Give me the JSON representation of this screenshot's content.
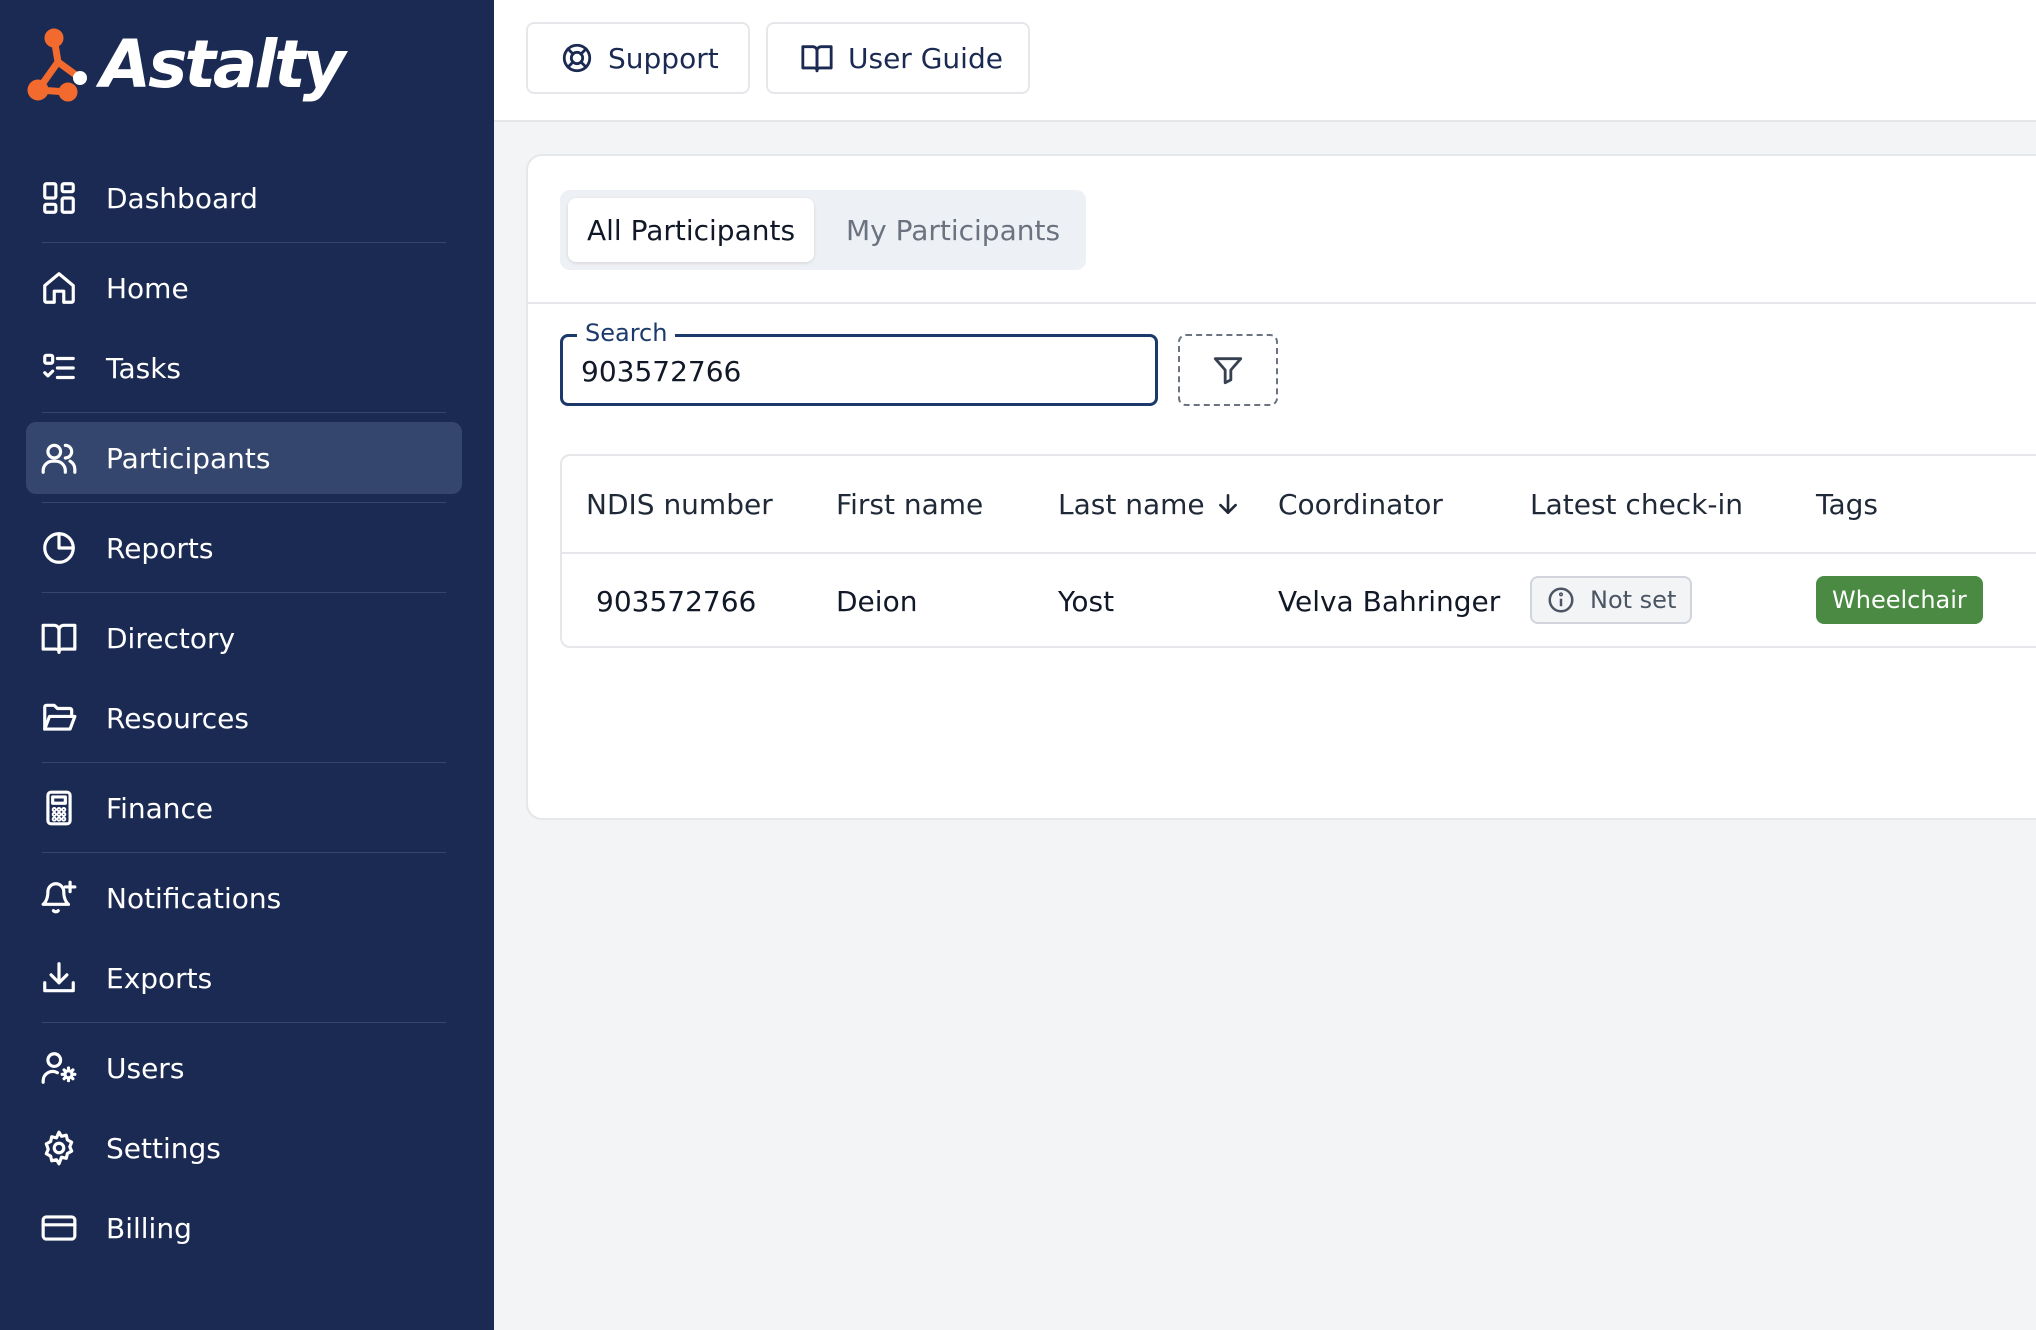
{
  "brand": {
    "name": "Astalty",
    "accent": "#f26a2e",
    "sidebar_bg": "#1b2a52"
  },
  "sidebar": {
    "items": [
      {
        "label": "Dashboard",
        "icon": "dashboard-icon",
        "active": false
      },
      {
        "label": "Home",
        "icon": "home-icon",
        "active": false
      },
      {
        "label": "Tasks",
        "icon": "tasks-icon",
        "active": false
      },
      {
        "label": "Participants",
        "icon": "participants-icon",
        "active": true
      },
      {
        "label": "Reports",
        "icon": "pie-chart-icon",
        "active": false
      },
      {
        "label": "Directory",
        "icon": "book-icon",
        "active": false
      },
      {
        "label": "Resources",
        "icon": "folder-icon",
        "active": false
      },
      {
        "label": "Finance",
        "icon": "calculator-icon",
        "active": false
      },
      {
        "label": "Notifications",
        "icon": "bell-plus-icon",
        "active": false
      },
      {
        "label": "Exports",
        "icon": "download-icon",
        "active": false
      },
      {
        "label": "Users",
        "icon": "user-gear-icon",
        "active": false
      },
      {
        "label": "Settings",
        "icon": "gear-icon",
        "active": false
      },
      {
        "label": "Billing",
        "icon": "credit-card-icon",
        "active": false
      }
    ]
  },
  "topbar": {
    "support_label": "Support",
    "user_guide_label": "User Guide"
  },
  "participants": {
    "tabs": [
      {
        "label": "All Participants",
        "active": true
      },
      {
        "label": "My Participants",
        "active": false
      }
    ],
    "search": {
      "label": "Search",
      "value": "903572766"
    },
    "table": {
      "columns": [
        "NDIS number",
        "First name",
        "Last name",
        "Coordinator",
        "Latest check-in",
        "Tags"
      ],
      "sorted_column": "Last name",
      "sort_direction": "descending",
      "rows": [
        {
          "ndis_number": "903572766",
          "first_name": "Deion",
          "last_name": "Yost",
          "coordinator": "Velva Bahringer",
          "latest_checkin": "Not set",
          "tags": [
            {
              "label": "Wheelchair",
              "color": "#4a8a43"
            }
          ]
        }
      ]
    }
  }
}
